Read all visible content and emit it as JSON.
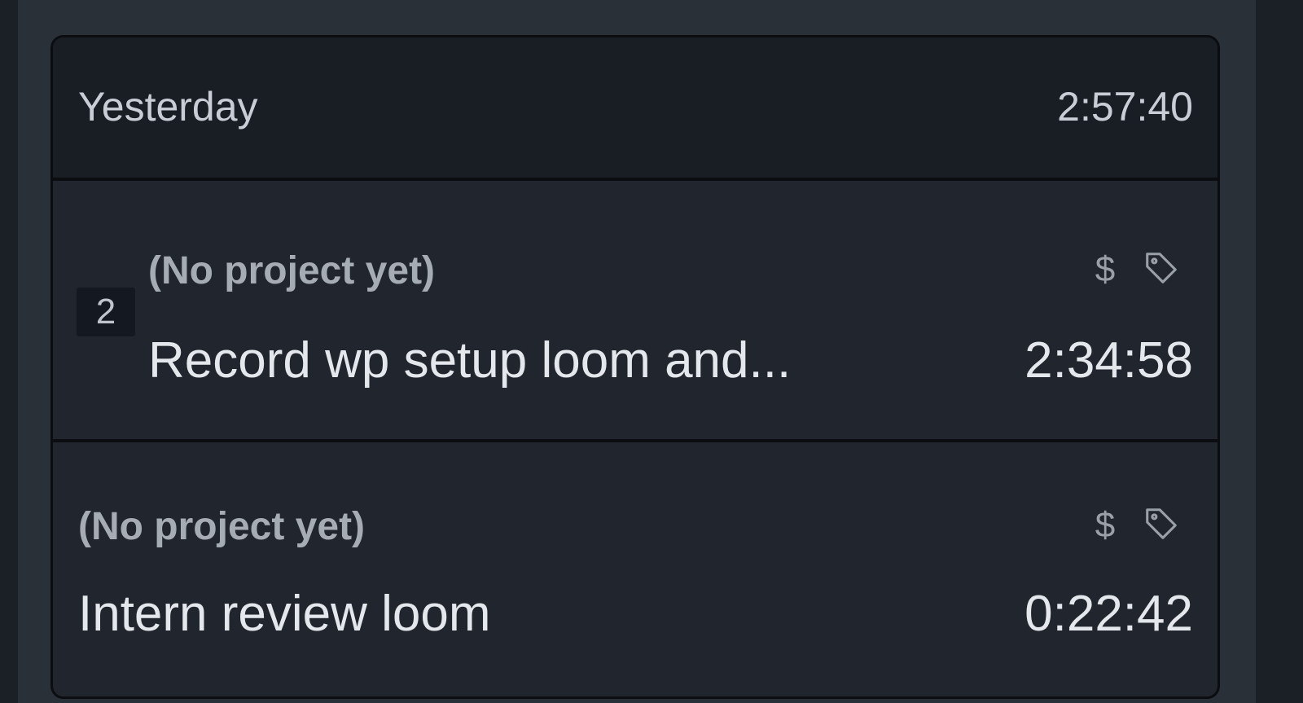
{
  "day_group": {
    "label": "Yesterday",
    "total": "2:57:40"
  },
  "entries": [
    {
      "group_count": "2",
      "project": "(No project yet)",
      "description": "Record wp setup loom and...",
      "duration": "2:34:58",
      "billable_symbol": "$",
      "icons": [
        "dollar-icon",
        "tag-icon"
      ]
    },
    {
      "project": "(No project yet)",
      "description": "Intern review loom",
      "duration": "0:22:42",
      "billable_symbol": "$",
      "icons": [
        "dollar-icon",
        "tag-icon"
      ]
    }
  ],
  "colors": {
    "background": "#1b2027",
    "panel": "#2a3038",
    "card": "#21262e",
    "header": "#191d24",
    "primary_text": "#e4e7eb",
    "secondary_text": "#a6acb4"
  }
}
